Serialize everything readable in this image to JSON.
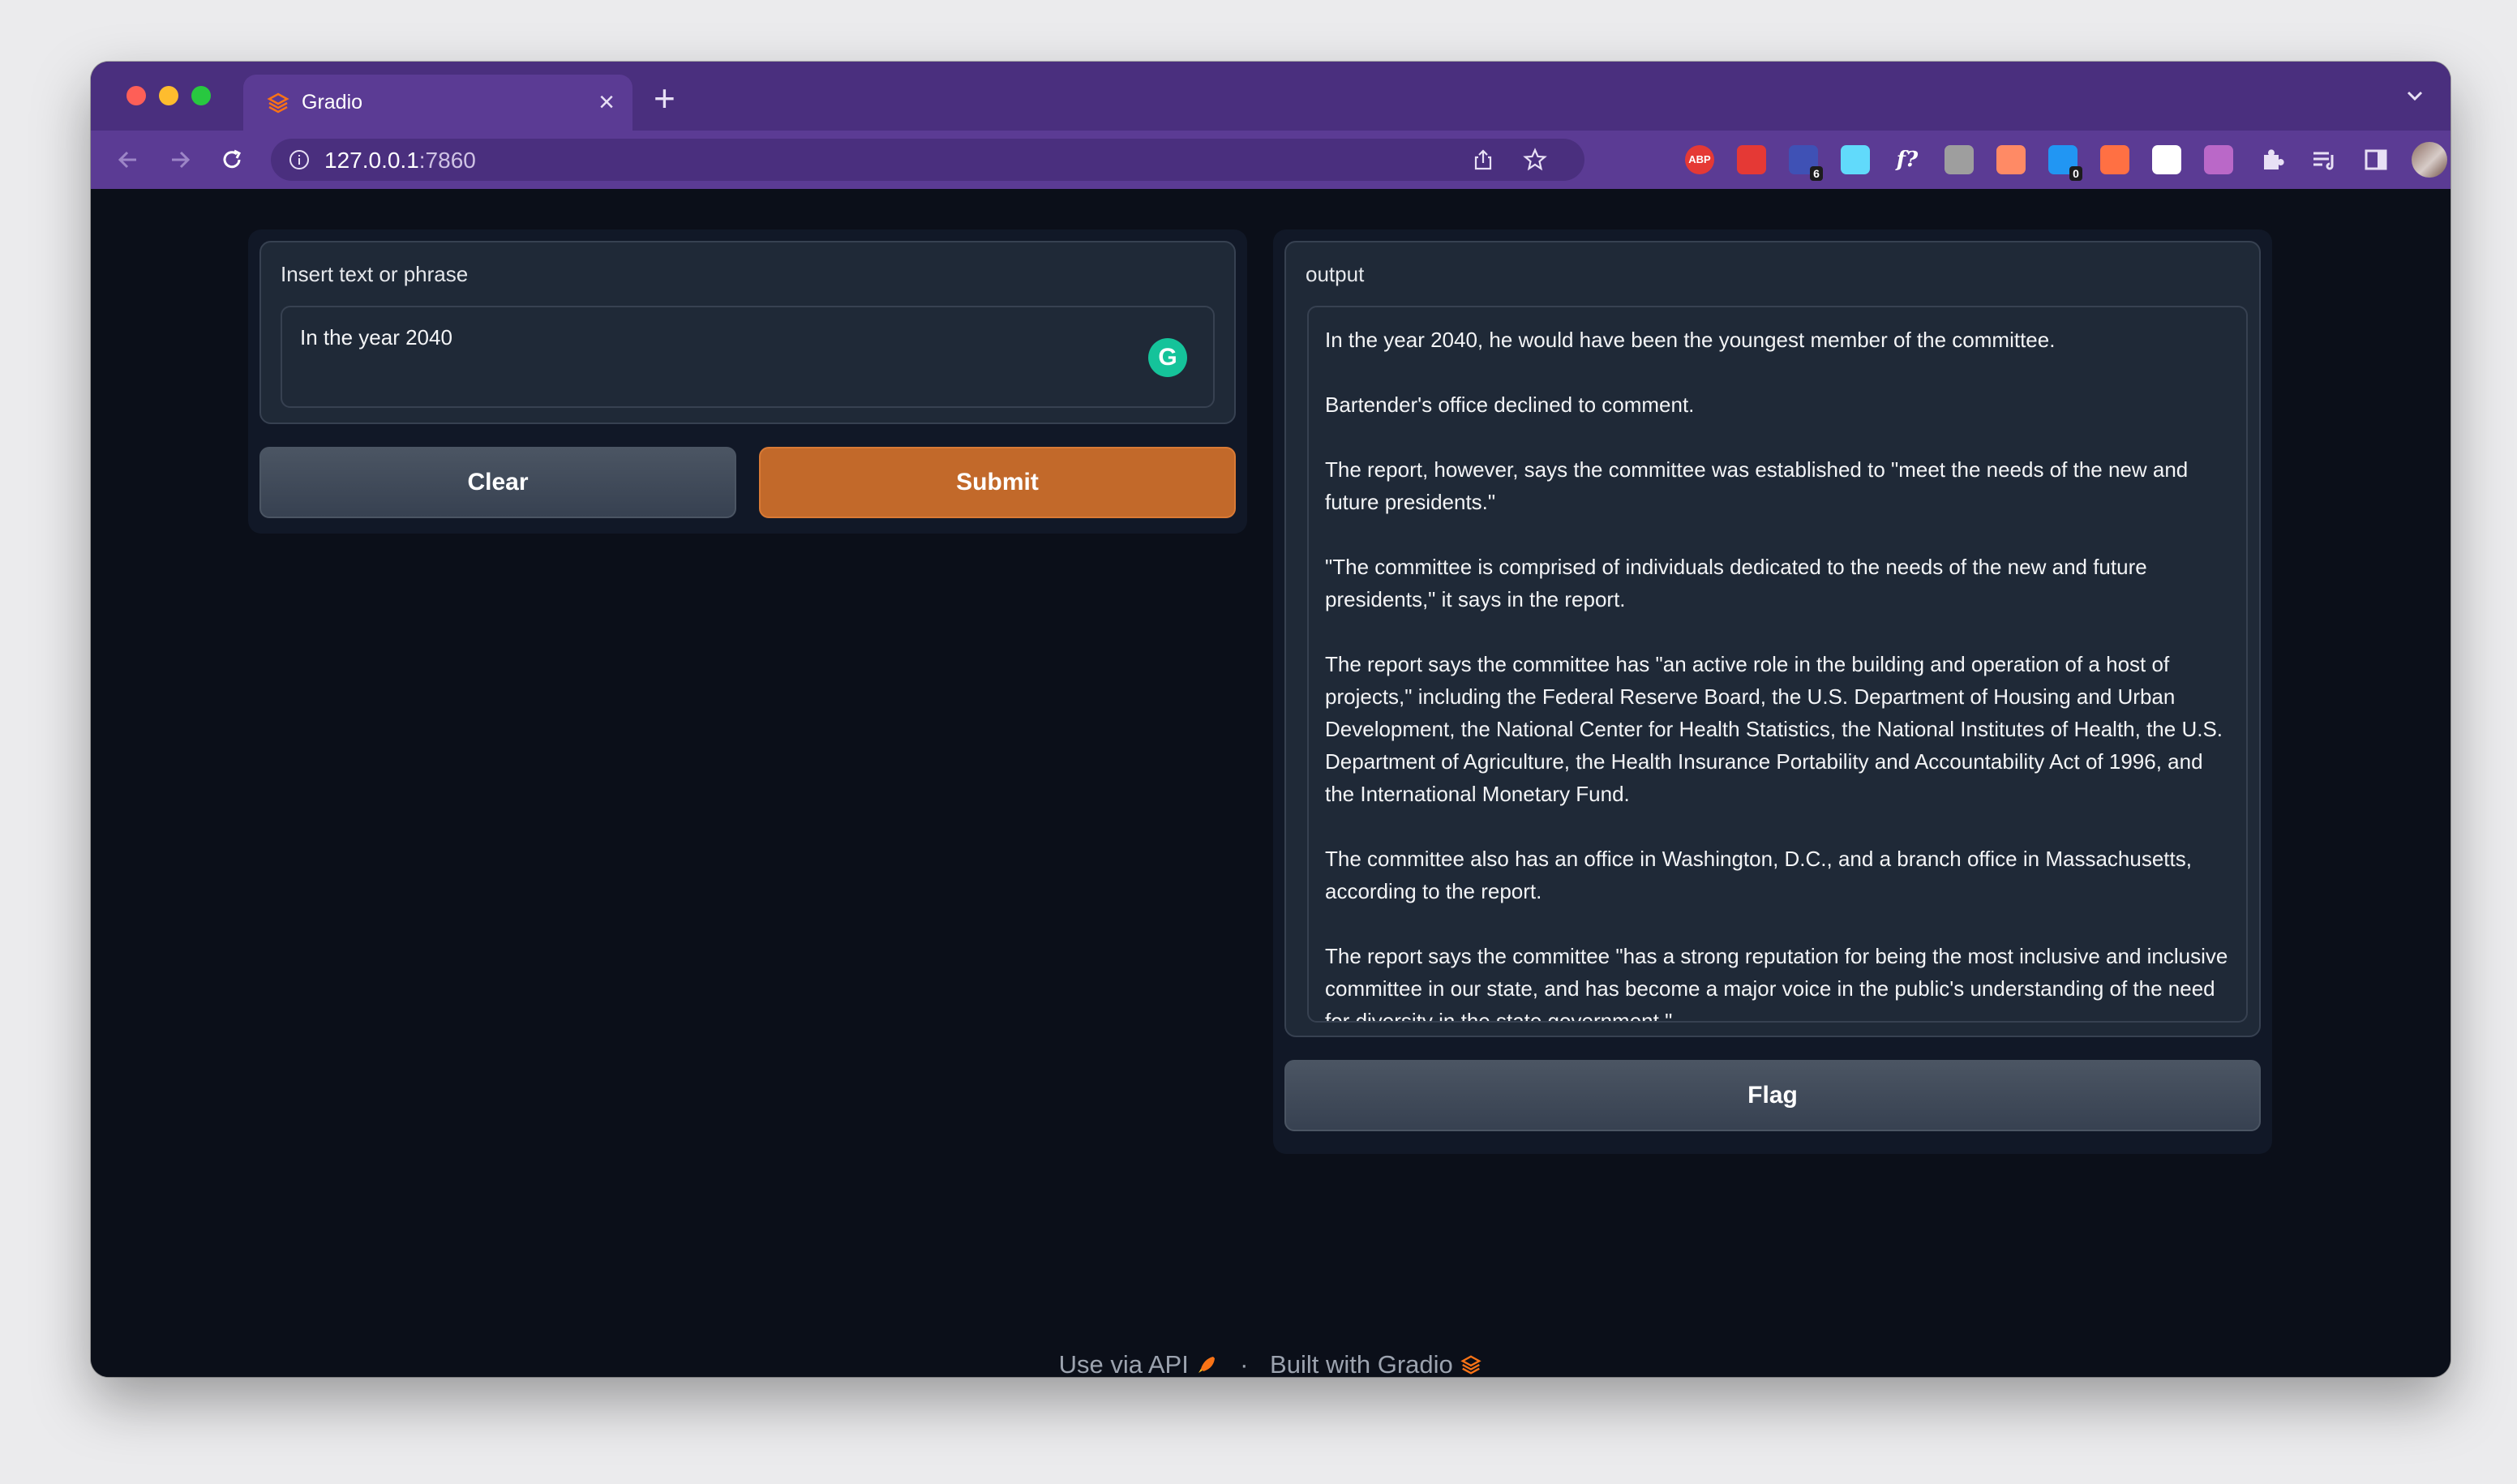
{
  "browser": {
    "tab_title": "Gradio",
    "url_host": "127.0.0.1",
    "url_port": ":7860",
    "extensions": [
      {
        "name": "adblock-plus-icon",
        "label": "ABP",
        "color": "#e53935"
      },
      {
        "name": "lock-extension-icon",
        "label": "",
        "color": "#e53935"
      },
      {
        "name": "diamond-extension-icon",
        "label": "",
        "color": "#3f51b5",
        "badge": "6"
      },
      {
        "name": "react-devtools-icon",
        "label": "",
        "color": "#61dafb"
      },
      {
        "name": "formula-extension-icon",
        "label": "f?",
        "color": "#ffffff"
      },
      {
        "name": "translate-extension-icon",
        "label": "",
        "color": "#9e9e9e"
      },
      {
        "name": "megaphone-extension-icon",
        "label": "",
        "color": "#ff8a65"
      },
      {
        "name": "bitwarden-icon",
        "label": "",
        "color": "#2196f3",
        "badge": "0"
      },
      {
        "name": "fire-extension-icon",
        "label": "",
        "color": "#ff7043"
      },
      {
        "name": "picture-in-picture-icon",
        "label": "",
        "color": "#ffffff"
      },
      {
        "name": "moon-extension-icon",
        "label": "",
        "color": "#ba68c8"
      }
    ]
  },
  "input": {
    "label": "Insert text or phrase",
    "value": "In the year 2040",
    "grammarly_label": "G"
  },
  "buttons": {
    "clear": "Clear",
    "submit": "Submit",
    "flag": "Flag"
  },
  "output": {
    "label": "output",
    "paragraphs": [
      "In the year 2040, he would have been the youngest member of the committee.",
      "Bartender's office declined to comment.",
      "The report, however, says the committee was established to \"meet the needs of the new and future presidents.\"",
      "\"The committee is comprised of individuals dedicated to the needs of the new and future presidents,\" it says in the report.",
      "The report says the committee has \"an active role in the building and operation of a host of projects,\" including the Federal Reserve Board, the U.S. Department of Housing and Urban Development, the National Center for Health Statistics, the National Institutes of Health, the U.S. Department of Agriculture, the Health Insurance Portability and Accountability Act of 1996, and the International Monetary Fund.",
      "The committee also has an office in Washington, D.C., and a branch office in Massachusetts, according to the report.",
      "The report says the committee \"has a strong reputation for being the most inclusive and inclusive committee in our state, and has become a major voice in the public's understanding of the need for diversity in the state government.\""
    ]
  },
  "footer": {
    "api_link": "Use via API",
    "separator": "·",
    "built_with": "Built with Gradio"
  },
  "colors": {
    "accent": "#c2692a",
    "page_bg": "#0b0f19",
    "browser_frame": "#5b3b94"
  }
}
